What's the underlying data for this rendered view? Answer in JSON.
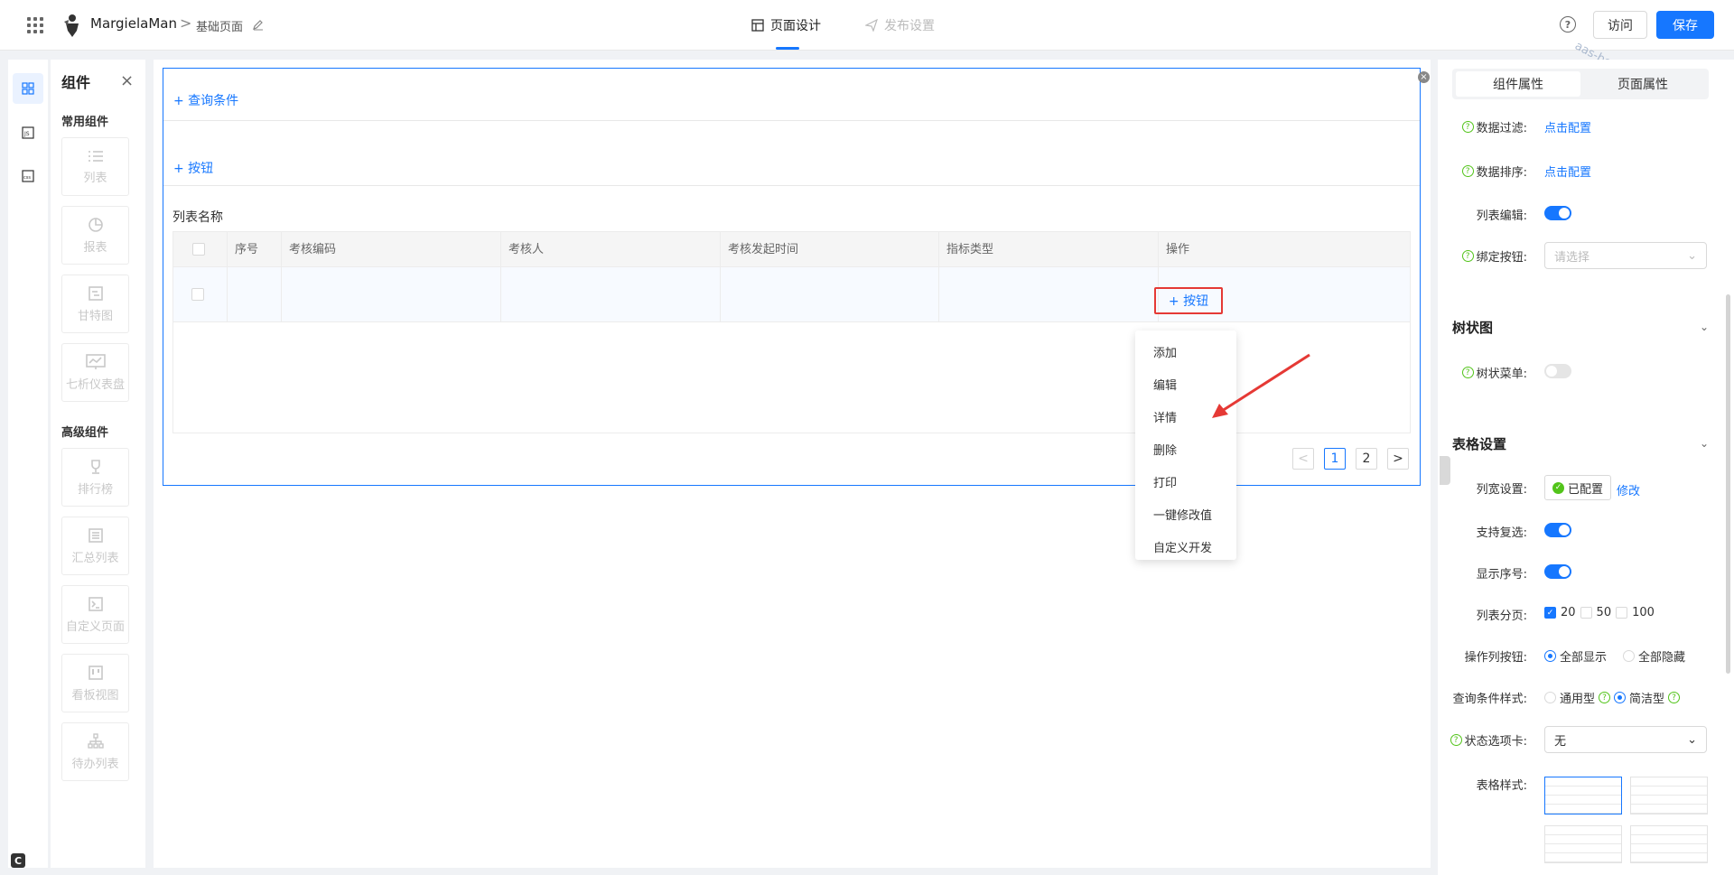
{
  "header": {
    "app_name": "MargielaMan",
    "breadcrumb_sep": ">",
    "page_name": "基础页面",
    "tab_design": "页面设计",
    "tab_publish": "发布设置",
    "help": "?",
    "visit_label": "访问",
    "save_label": "保存",
    "watermark": "aas-beta-最实环境"
  },
  "rail": {
    "c_badge": "C"
  },
  "components": {
    "title": "组件",
    "close": "×",
    "common_title": "常用组件",
    "common": [
      {
        "label": "列表",
        "icon": "list-icon"
      },
      {
        "label": "报表",
        "icon": "pie-icon"
      },
      {
        "label": "甘特图",
        "icon": "gantt-icon"
      },
      {
        "label": "七析仪表盘",
        "icon": "dashboard-icon"
      }
    ],
    "advanced_title": "高级组件",
    "advanced": [
      {
        "label": "排行榜",
        "icon": "trophy-icon"
      },
      {
        "label": "汇总列表",
        "icon": "summary-icon"
      },
      {
        "label": "自定义页面",
        "icon": "terminal-icon"
      },
      {
        "label": "看板视图",
        "icon": "kanban-icon"
      },
      {
        "label": "待办列表",
        "icon": "tree-icon"
      }
    ]
  },
  "canvas": {
    "query_link": "+ 查询条件",
    "button_link": "+ 按钮",
    "list_name": "列表名称",
    "columns": [
      "序号",
      "考核编码",
      "考核人",
      "考核发起时间",
      "指标类型",
      "操作"
    ],
    "row_button": "+ 按钮",
    "pager": {
      "prev": "<",
      "pages": [
        "1",
        "2"
      ],
      "next": ">",
      "current": "1"
    },
    "frame_close": "×"
  },
  "menu": {
    "items": [
      "添加",
      "编辑",
      "详情",
      "删除",
      "打印",
      "一键修改值",
      "自定义开发"
    ]
  },
  "props": {
    "tab_component": "组件属性",
    "tab_page": "页面属性",
    "data_filter_label": "数据过滤:",
    "data_filter_link": "点击配置",
    "data_sort_label": "数据排序:",
    "data_sort_link": "点击配置",
    "list_edit_label": "列表编辑:",
    "bind_button_label": "绑定按钮:",
    "bind_button_placeholder": "请选择",
    "tree_section": "树状图",
    "tree_menu_label": "树状菜单:",
    "table_section": "表格设置",
    "col_width_label": "列宽设置:",
    "col_width_value": "已配置",
    "col_width_modify": "修改",
    "multi_select_label": "支持复选:",
    "show_index_label": "显示序号:",
    "paging_label": "列表分页:",
    "paging_options": [
      "20",
      "50",
      "100"
    ],
    "op_buttons_label": "操作列按钮:",
    "op_buttons_options": [
      "全部显示",
      "全部隐藏"
    ],
    "query_style_label": "查询条件样式:",
    "query_style_options": [
      "通用型",
      "简洁型"
    ],
    "status_tab_label": "状态选项卡:",
    "status_tab_value": "无",
    "table_style_label": "表格样式:"
  },
  "colors": {
    "accent": "#1677ff",
    "highlight_border": "#e53935",
    "success": "#52c41a"
  }
}
